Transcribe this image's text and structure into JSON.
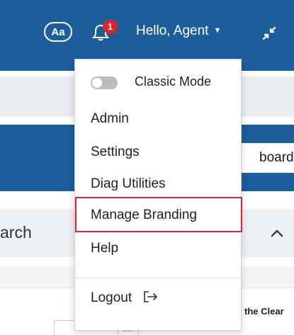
{
  "header": {
    "font_button_label": "Aa",
    "notification_count": "1",
    "greeting": "Hello, Agent",
    "icons": [
      "font-size-icon",
      "bell-icon",
      "caret-down-icon",
      "shrink-icon"
    ]
  },
  "background": {
    "dashboard_tab": "board",
    "panel_title": "arch",
    "partial_text": "the Clear"
  },
  "menu": {
    "classic_mode_label": "Classic Mode",
    "classic_mode_enabled": false,
    "items": [
      {
        "label": "Admin"
      },
      {
        "label": "Settings"
      },
      {
        "label": "Diag Utilities"
      },
      {
        "label": "Manage Branding",
        "highlighted": true
      },
      {
        "label": "Help"
      }
    ],
    "logout_label": "Logout"
  },
  "colors": {
    "header_bg": "#1c5e9c",
    "badge": "#d6282c",
    "highlight_border": "#d42a35",
    "toggle_off": "#b9bdc1"
  }
}
